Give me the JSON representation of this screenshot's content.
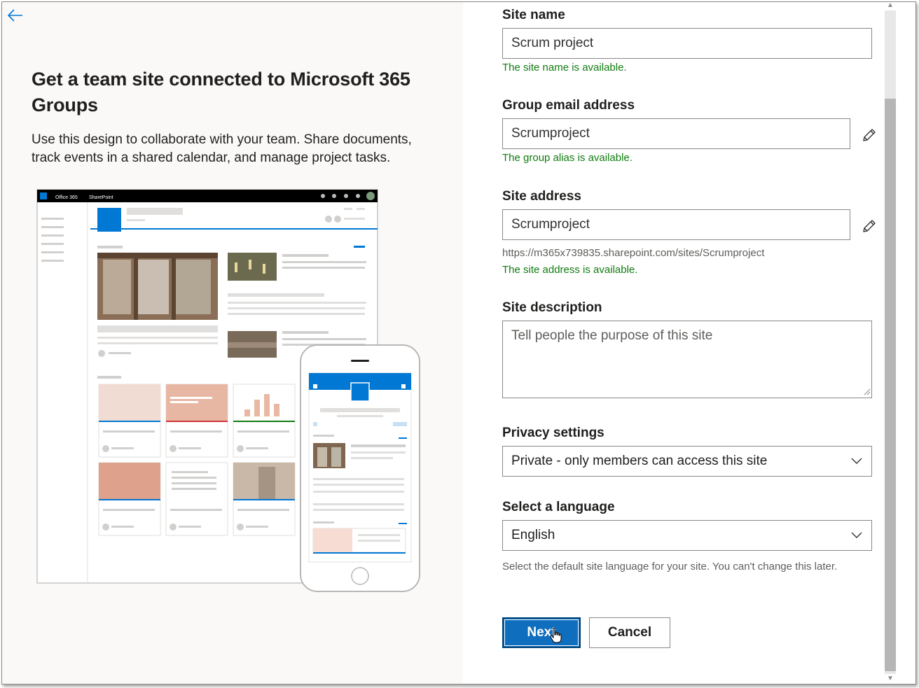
{
  "left": {
    "title": "Get a team site connected to Microsoft 365 Groups",
    "description": "Use this design to collaborate with your team. Share documents, track events in a shared calendar, and manage project tasks.",
    "preview": {
      "brand": "Office 365",
      "app": "SharePoint"
    }
  },
  "form": {
    "site_name": {
      "label": "Site name",
      "value": "Scrum project",
      "status": "The site name is available."
    },
    "group_email": {
      "label": "Group email address",
      "value": "Scrumproject",
      "status": "The group alias is available."
    },
    "site_address": {
      "label": "Site address",
      "value": "Scrumproject",
      "url": "https://m365x739835.sharepoint.com/sites/Scrumproject",
      "status": "The site address is available."
    },
    "site_description": {
      "label": "Site description",
      "placeholder": "Tell people the purpose of this site"
    },
    "privacy": {
      "label": "Privacy settings",
      "selected": "Private - only members can access this site"
    },
    "language": {
      "label": "Select a language",
      "selected": "English",
      "hint": "Select the default site language for your site. You can't change this later."
    },
    "next_label": "Next",
    "cancel_label": "Cancel"
  },
  "icons": {
    "back": "back-arrow-icon",
    "edit": "pencil-icon",
    "dropdown": "chevron-down-icon"
  },
  "colors": {
    "success": "#107c10",
    "primary": "#106ebe",
    "accent_blue": "#0078d4"
  }
}
